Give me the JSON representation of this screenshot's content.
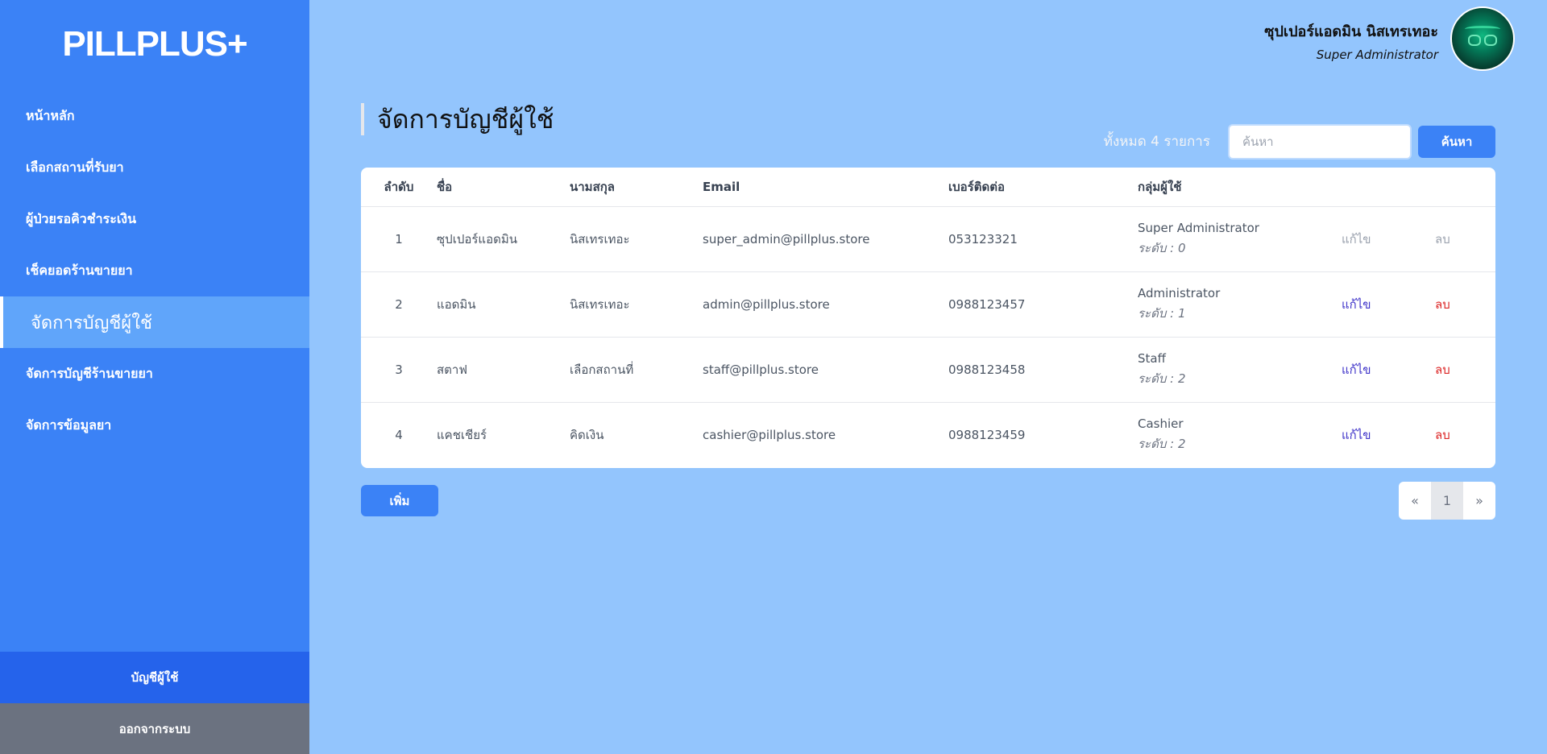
{
  "sidebar": {
    "logo": "PILLPLUS+",
    "items": [
      {
        "label": "หน้าหลัก"
      },
      {
        "label": "เลือกสถานที่รับยา"
      },
      {
        "label": "ผู้ป่วยรอคิวชำระเงิน"
      },
      {
        "label": "เช็คยอดร้านขายยา"
      },
      {
        "label": "จัดการบัญชีผู้ใช้"
      },
      {
        "label": "จัดการบัญชีร้านขายยา"
      },
      {
        "label": "จัดการข้อมูลยา"
      }
    ],
    "account_label": "บัญชีผู้ใช้",
    "logout_label": "ออกจากระบบ"
  },
  "header": {
    "user_name": "ซุปเปอร์แอดมิน นิสเทรเทอะ",
    "user_role": "Super Administrator"
  },
  "main": {
    "title": "จัดการบัญชีผู้ใช้",
    "total_text": "ทั้งหมด 4 รายการ",
    "search_placeholder": "ค้นหา",
    "search_button": "ค้นหา",
    "add_button": "เพิ่ม",
    "columns": [
      "ลำดับ",
      "ชื่อ",
      "นามสกุล",
      "Email",
      "เบอร์ติดต่อ",
      "กลุ่มผู้ใช้"
    ],
    "rows": [
      {
        "no": "1",
        "first": "ซุปเปอร์แอดมิน",
        "last": "นิสเทรเทอะ",
        "email": "super_admin@pillplus.store",
        "phone": "053123321",
        "group": "Super Administrator",
        "level": "ระดับ : 0",
        "edit": "แก้ไข",
        "delete": "ลบ"
      },
      {
        "no": "2",
        "first": "แอดมิน",
        "last": "นิสเทรเทอะ",
        "email": "admin@pillplus.store",
        "phone": "0988123457",
        "group": "Administrator",
        "level": "ระดับ : 1",
        "edit": "แก้ไข",
        "delete": "ลบ"
      },
      {
        "no": "3",
        "first": "สตาฟ",
        "last": "เลือกสถานที่",
        "email": "staff@pillplus.store",
        "phone": "0988123458",
        "group": "Staff",
        "level": "ระดับ : 2",
        "edit": "แก้ไข",
        "delete": "ลบ"
      },
      {
        "no": "4",
        "first": "แคชเชียร์",
        "last": "คิดเงิน",
        "email": "cashier@pillplus.store",
        "phone": "0988123459",
        "group": "Cashier",
        "level": "ระดับ : 2",
        "edit": "แก้ไข",
        "delete": "ลบ"
      }
    ],
    "pagination": {
      "prev": "«",
      "current": "1",
      "next": "»"
    }
  },
  "colors": {
    "sidebar_bg": "#3b82f6",
    "page_bg": "#93c5fd",
    "active_item_bg": "#60a5fa",
    "account_bg": "#2563eb",
    "logout_bg": "#6b7280",
    "edit_link": "#4338ca",
    "delete_link": "#dc2626"
  }
}
